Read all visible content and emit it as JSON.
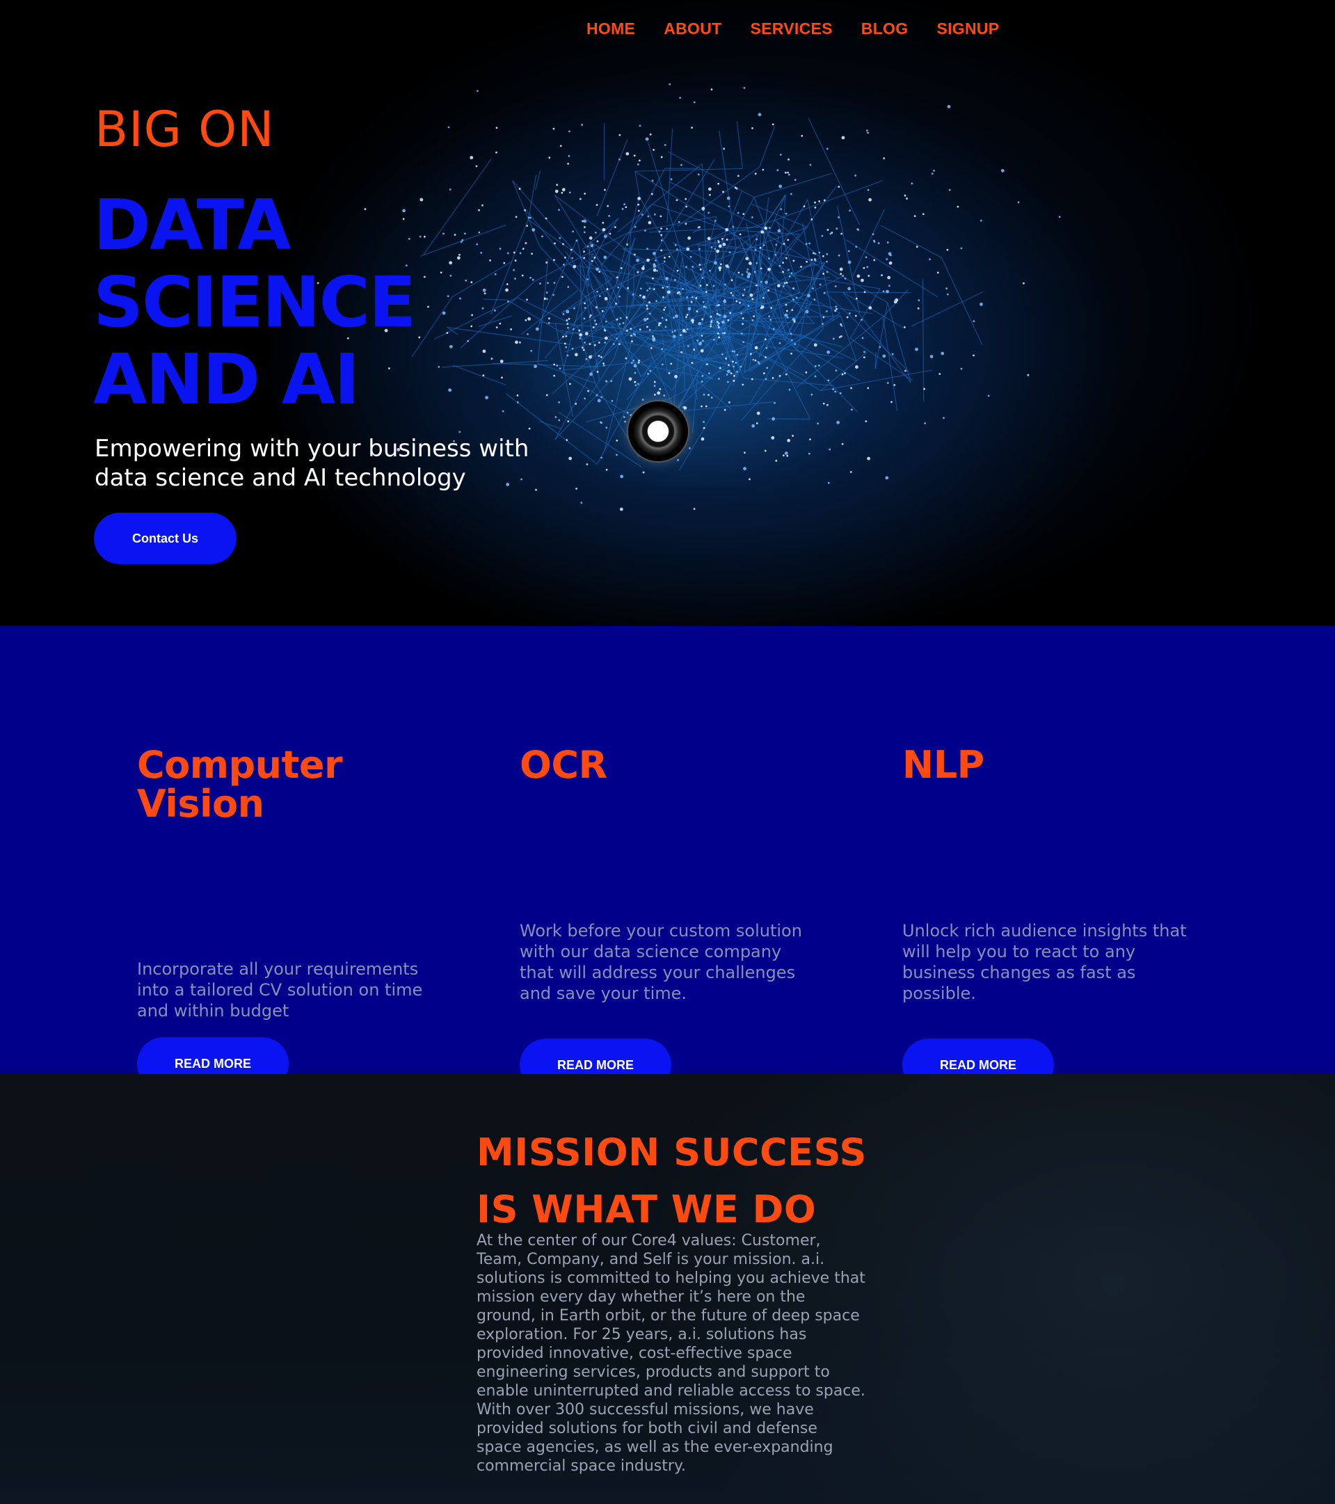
{
  "nav": {
    "items": [
      "HOME",
      "ABOUT",
      "SERVICES",
      "BLOG",
      "SIGNUP"
    ]
  },
  "hero": {
    "kicker": "BIG ON",
    "title_lines": [
      "DATA",
      "SCIENCE",
      "AND AI"
    ],
    "subtitle": "Empowering with your business with data science and AI technology",
    "cta_label": "Contact Us"
  },
  "services": [
    {
      "title": "Computer Vision",
      "description": "Incorporate all your requirements into a tailored CV solution on time and within budget",
      "button_label": "READ MORE"
    },
    {
      "title": "OCR",
      "description": "Work before your custom solution with our data science company that will address your challenges and save your time.",
      "button_label": "READ MORE"
    },
    {
      "title": "NLP",
      "description": "Unlock rich audience insights that will help you to react to any business changes as fast as possible.",
      "button_label": "READ MORE"
    }
  ],
  "mission": {
    "title_lines": [
      "MISSION SUCCESS",
      "IS WHAT WE DO"
    ],
    "text": "At the center of our Core4 values: Customer, Team, Company, and Self is your mission. a.i. solutions is committed to helping you achieve that mission every day whether it’s here on the ground, in Earth orbit, or the future of deep space exploration. For 25 years, a.i. solutions has provided innovative, cost-effective space engineering services, products and support to enable uninterrupted and reliable access to space. With over 300 successful missions, we have provided solutions for both civil and defense space agencies, as well as the ever-expanding commercial space industry."
  },
  "colors": {
    "accent_orange": "#ff4a12",
    "primary_blue": "#0a14f0",
    "services_bg": "#00008b",
    "muted_text": "#8a8fb8"
  }
}
